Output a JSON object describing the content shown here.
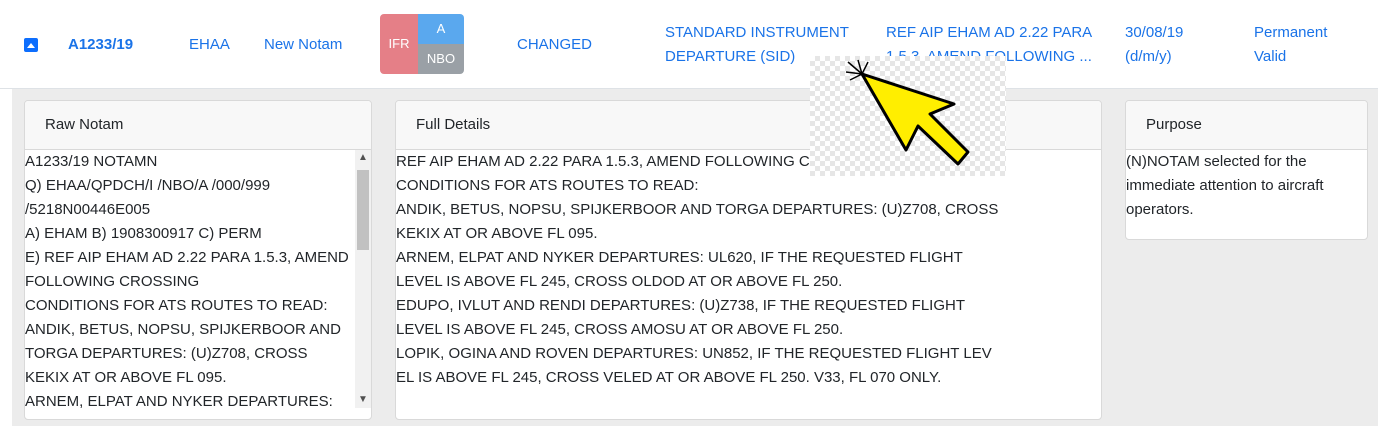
{
  "row": {
    "id": "A1233/19",
    "location": "EHAA",
    "type": "New Notam",
    "badges": {
      "flight_rule": "IFR",
      "scope": "A",
      "purpose_code": "NBO"
    },
    "status": "CHANGED",
    "subject_line1": "STANDARD INSTRUMENT",
    "subject_line2": "DEPARTURE (SID)",
    "summary_line1": "REF AIP EHAM AD 2.22 PARA",
    "summary_line2": "1.5.3, AMEND FOLLOWING ...",
    "date_line1": "30/08/19",
    "date_line2": "(d/m/y)",
    "validity_line1": "Permanent",
    "validity_line2": "Valid"
  },
  "raw_notam": {
    "header": "Raw Notam",
    "lines": [
      "A1233/19 NOTAMN",
      "Q) EHAA/QPDCH/I /NBO/A /000/999",
      "/5218N00446E005",
      "A) EHAM B) 1908300917 C) PERM",
      "E) REF AIP EHAM AD 2.22 PARA 1.5.3, AMEND",
      "FOLLOWING CROSSING",
      "CONDITIONS FOR ATS ROUTES TO READ:",
      "ANDIK, BETUS, NOPSU, SPIJKERBOOR AND",
      "TORGA DEPARTURES: (U)Z708, CROSS",
      "KEKIX AT OR ABOVE FL 095.",
      "ARNEM, ELPAT AND NYKER DEPARTURES:"
    ]
  },
  "full_details": {
    "header": "Full Details",
    "lines": [
      "REF AIP EHAM AD 2.22 PARA 1.5.3, AMEND FOLLOWING CROSSING",
      "CONDITIONS FOR ATS ROUTES TO READ:",
      "ANDIK, BETUS, NOPSU, SPIJKERBOOR AND TORGA DEPARTURES: (U)Z708, CROSS",
      "KEKIX AT OR ABOVE FL 095.",
      "ARNEM, ELPAT AND NYKER DEPARTURES: UL620, IF THE REQUESTED FLIGHT",
      "LEVEL IS ABOVE FL 245, CROSS OLDOD AT OR ABOVE FL 250.",
      "EDUPO, IVLUT AND RENDI DEPARTURES: (U)Z738, IF THE REQUESTED FLIGHT",
      "LEVEL IS ABOVE FL 245, CROSS AMOSU AT OR ABOVE FL 250.",
      "LOPIK, OGINA AND ROVEN DEPARTURES: UN852, IF THE REQUESTED FLIGHT LEV",
      "EL IS ABOVE FL 245, CROSS VELED AT OR ABOVE FL 250. V33, FL 070 ONLY."
    ]
  },
  "purpose": {
    "header": "Purpose",
    "lines": [
      "(N)NOTAM selected for the",
      "immediate attention to aircraft",
      "operators."
    ]
  },
  "icons": {
    "toggle": "collapse-caret-up-icon",
    "cursor": "pointer-arrow-icon",
    "scroll_up": "scroll-up-arrow-icon",
    "scroll_down": "scroll-down-arrow-icon"
  },
  "colors": {
    "link": "#1a73e8",
    "ifr": "#e57f87",
    "scope": "#5aa8ee",
    "purpose_code": "#9aa0a6",
    "cursor": "#ffee00"
  }
}
